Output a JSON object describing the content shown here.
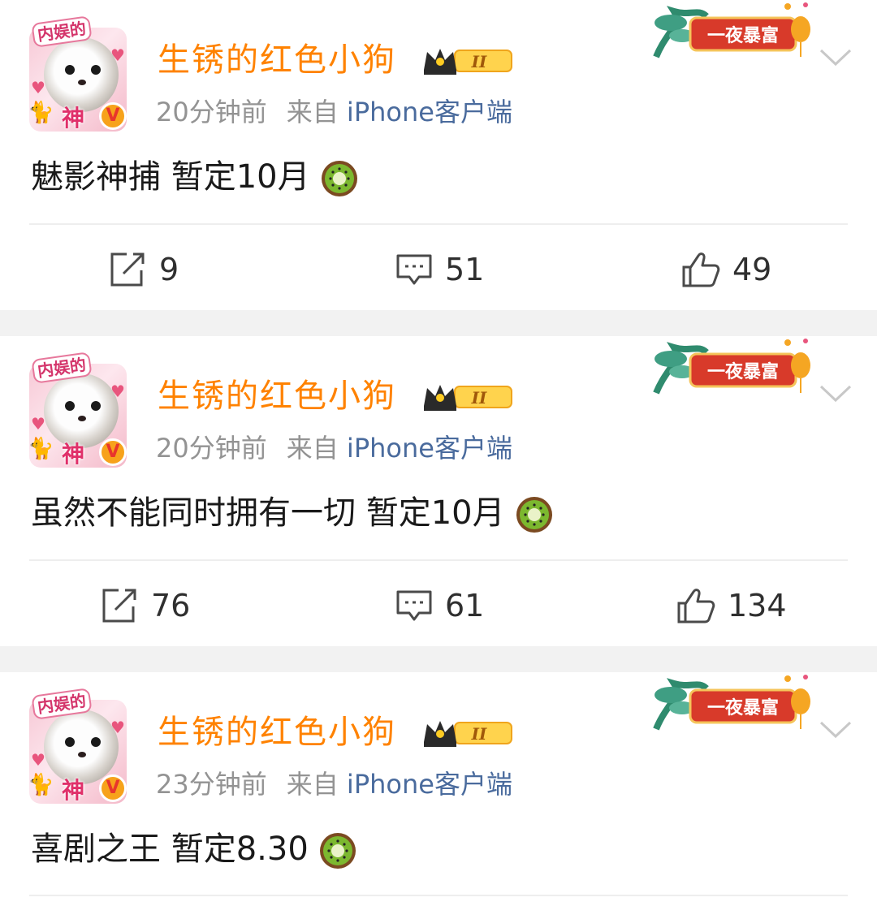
{
  "posts": [
    {
      "avatar_tag": "内娱的",
      "avatar_badge_text": "神",
      "verified_mark": "V",
      "username": "生锈的红色小狗",
      "level_badge": "II",
      "time": "20分钟前",
      "source_prefix": "来自",
      "client": "iPhone客户端",
      "promo_label": "一夜暴富",
      "text": "魅影神捕 暂定10月",
      "emoji": "kiwi-icon",
      "reposts": "9",
      "comments": "51",
      "likes": "49"
    },
    {
      "avatar_tag": "内娱的",
      "avatar_badge_text": "神",
      "verified_mark": "V",
      "username": "生锈的红色小狗",
      "level_badge": "II",
      "time": "20分钟前",
      "source_prefix": "来自",
      "client": "iPhone客户端",
      "promo_label": "一夜暴富",
      "text": "虽然不能同时拥有一切 暂定10月",
      "emoji": "kiwi-icon",
      "reposts": "76",
      "comments": "61",
      "likes": "134"
    },
    {
      "avatar_tag": "内娱的",
      "avatar_badge_text": "神",
      "verified_mark": "V",
      "username": "生锈的红色小狗",
      "level_badge": "II",
      "time": "23分钟前",
      "source_prefix": "来自",
      "client": "iPhone客户端",
      "promo_label": "一夜暴富",
      "text": "喜剧之王 暂定8.30",
      "emoji": "kiwi-icon"
    }
  ],
  "colors": {
    "username": "#ff8200",
    "meta": "#939393",
    "client_link": "#4a6b9d",
    "gap": "#f2f2f2",
    "promo_red": "#d83a2a"
  }
}
